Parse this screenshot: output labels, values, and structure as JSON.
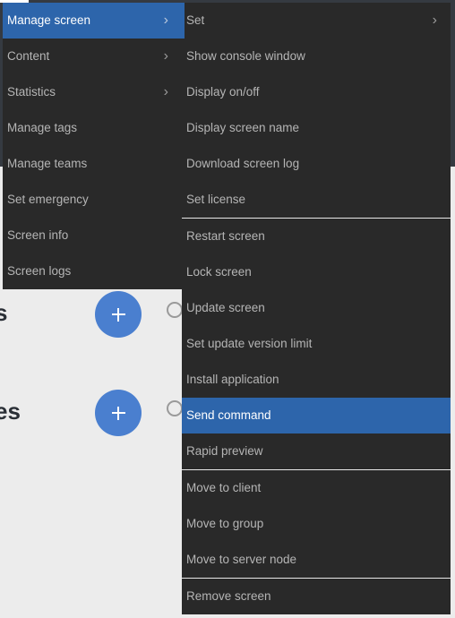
{
  "background": {
    "headings": [
      "s",
      "es"
    ],
    "add_button_label": "+"
  },
  "main_menu": {
    "items": [
      {
        "label": "Manage screen",
        "has_submenu": true,
        "active": true
      },
      {
        "label": "Content",
        "has_submenu": true
      },
      {
        "label": "Statistics",
        "has_submenu": true
      },
      {
        "label": "Manage tags"
      },
      {
        "label": "Manage teams"
      },
      {
        "label": "Set emergency"
      },
      {
        "label": "Screen info"
      },
      {
        "label": "Screen logs"
      }
    ]
  },
  "submenu": {
    "groups": [
      [
        {
          "label": "Set",
          "has_submenu": true
        },
        {
          "label": "Show console window"
        },
        {
          "label": "Display on/off"
        },
        {
          "label": "Display screen name"
        },
        {
          "label": "Download screen log"
        },
        {
          "label": "Set license"
        }
      ],
      [
        {
          "label": "Restart screen"
        },
        {
          "label": "Lock screen"
        },
        {
          "label": "Update screen"
        },
        {
          "label": "Set update version limit"
        },
        {
          "label": "Install application"
        },
        {
          "label": "Send command",
          "active": true
        },
        {
          "label": "Rapid preview"
        }
      ],
      [
        {
          "label": "Move to client"
        },
        {
          "label": "Move to group"
        },
        {
          "label": "Move to server node"
        }
      ],
      [
        {
          "label": "Remove screen"
        }
      ]
    ]
  },
  "icons": {
    "chevron": "›"
  },
  "colors": {
    "menu_bg": "#292929",
    "active_bg": "#2d65ab",
    "accent": "#4a7fcf"
  }
}
